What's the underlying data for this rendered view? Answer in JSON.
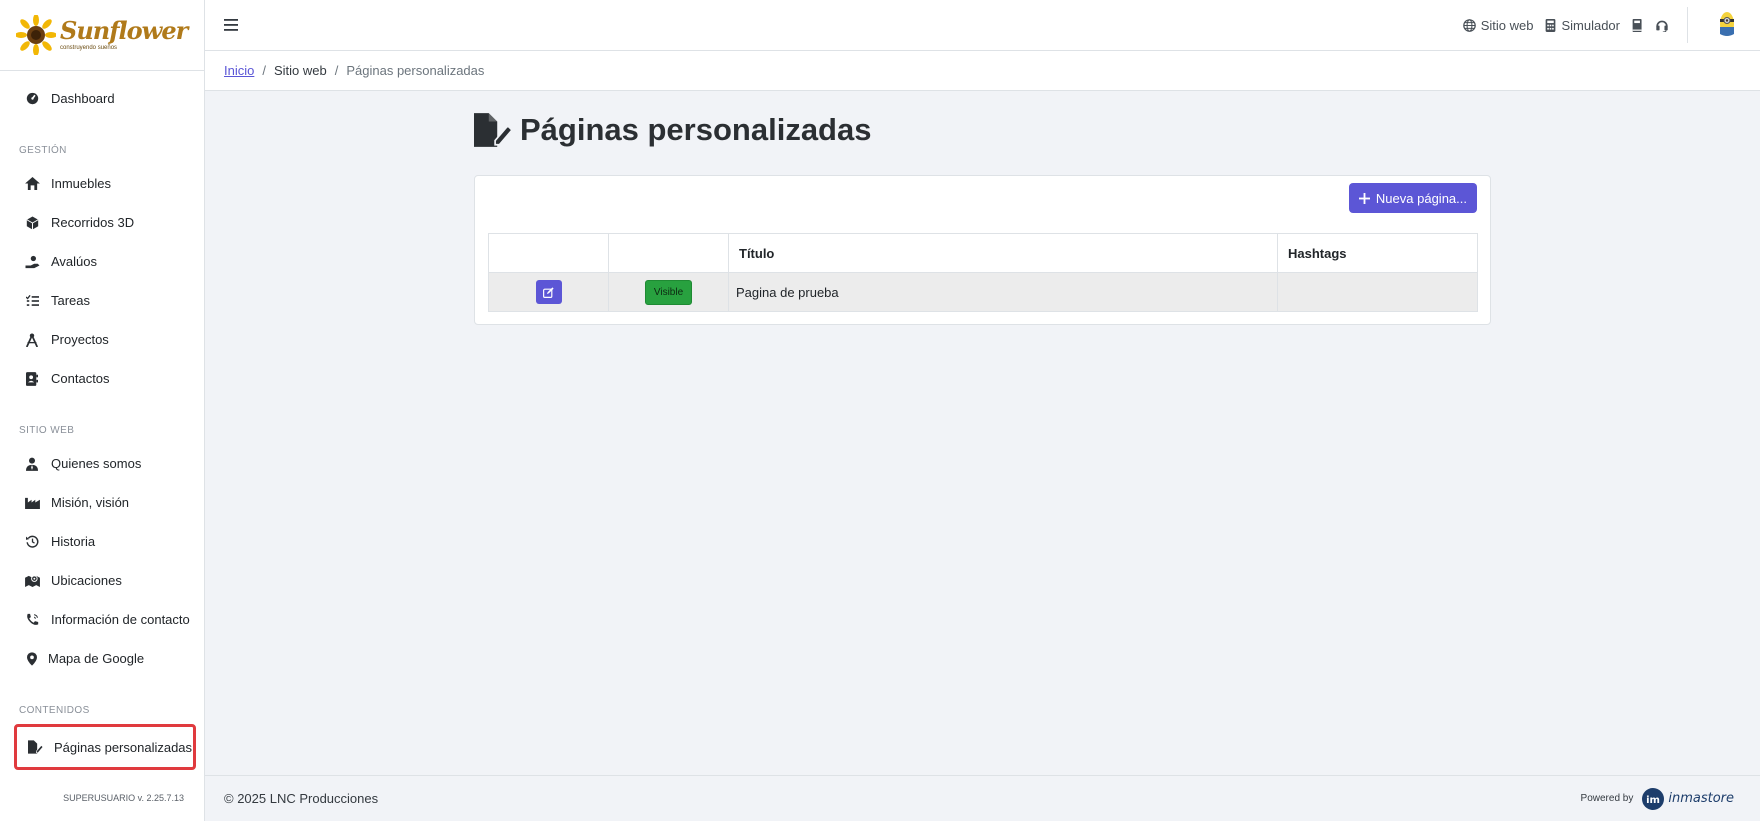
{
  "sidebar": {
    "logo_word": "Sunflower",
    "logo_tagline": "construyendo sueños",
    "items": {
      "dashboard": "Dashboard",
      "inmuebles": "Inmuebles",
      "recorridos": "Recorridos 3D",
      "avaluos": "Avalúos",
      "tareas": "Tareas",
      "proyectos": "Proyectos",
      "contactos": "Contactos",
      "quienes": "Quienes somos",
      "mision": "Misión, visión",
      "historia": "Historia",
      "ubicaciones": "Ubicaciones",
      "info_contacto": "Información de contacto",
      "mapa": "Mapa de Google",
      "paginas": "Páginas personalizadas"
    },
    "sections": {
      "gestion": "GESTIÓN",
      "sitio_web": "SITIO WEB",
      "contenidos": "CONTENIDOS"
    },
    "version": "SUPERUSUARIO v. 2.25.7.13"
  },
  "topbar": {
    "sitio_web": "Sitio web",
    "simulador": "Simulador"
  },
  "breadcrumb": {
    "inicio": "Inicio",
    "sitio_web": "Sitio web",
    "current": "Páginas personalizadas"
  },
  "page": {
    "title": "Páginas personalizadas",
    "new_button": "Nueva página..."
  },
  "table": {
    "headers": [
      "",
      "",
      "Título",
      "Hashtags"
    ],
    "rows": [
      {
        "status": "Visible",
        "titulo": "Pagina de prueba",
        "hashtags": ""
      }
    ]
  },
  "footer": {
    "copyright": "© 2025 LNC Producciones",
    "powered_by": "Powered by",
    "brand": "inmastore"
  },
  "colors": {
    "accent": "#5c56d6",
    "visible_badge": "#28a13f",
    "highlight_border": "#e03a3e"
  }
}
